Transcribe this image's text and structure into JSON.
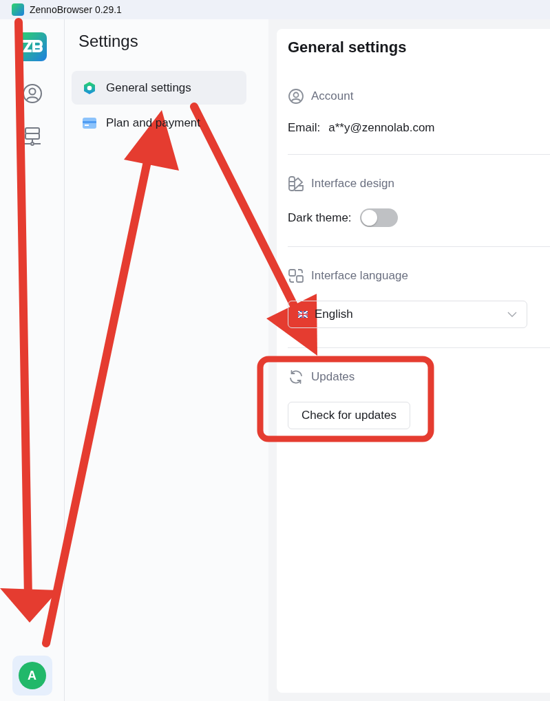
{
  "window": {
    "title": "ZennoBrowser 0.29.1"
  },
  "rail": {
    "items": [
      {
        "kind": "logo",
        "selected": false
      },
      {
        "kind": "profiles",
        "selected": false
      },
      {
        "kind": "proxies",
        "selected": false
      }
    ],
    "avatar": {
      "letter": "A"
    }
  },
  "sidebar": {
    "title": "Settings",
    "items": [
      {
        "label": "General settings",
        "kind": "general",
        "selected": true
      },
      {
        "label": "Plan and payment",
        "kind": "plan",
        "selected": false
      }
    ]
  },
  "content": {
    "title": "General settings",
    "sections": [
      {
        "kind": "account",
        "heading": "Account",
        "label": "Email:",
        "value": "a**y@zennolab.com"
      },
      {
        "kind": "design",
        "heading": "Interface design",
        "label": "Dark theme:",
        "on": false
      },
      {
        "kind": "language",
        "heading": "Interface language",
        "value": "English"
      },
      {
        "kind": "updates",
        "heading": "Updates",
        "button": "Check for updates"
      }
    ]
  }
}
